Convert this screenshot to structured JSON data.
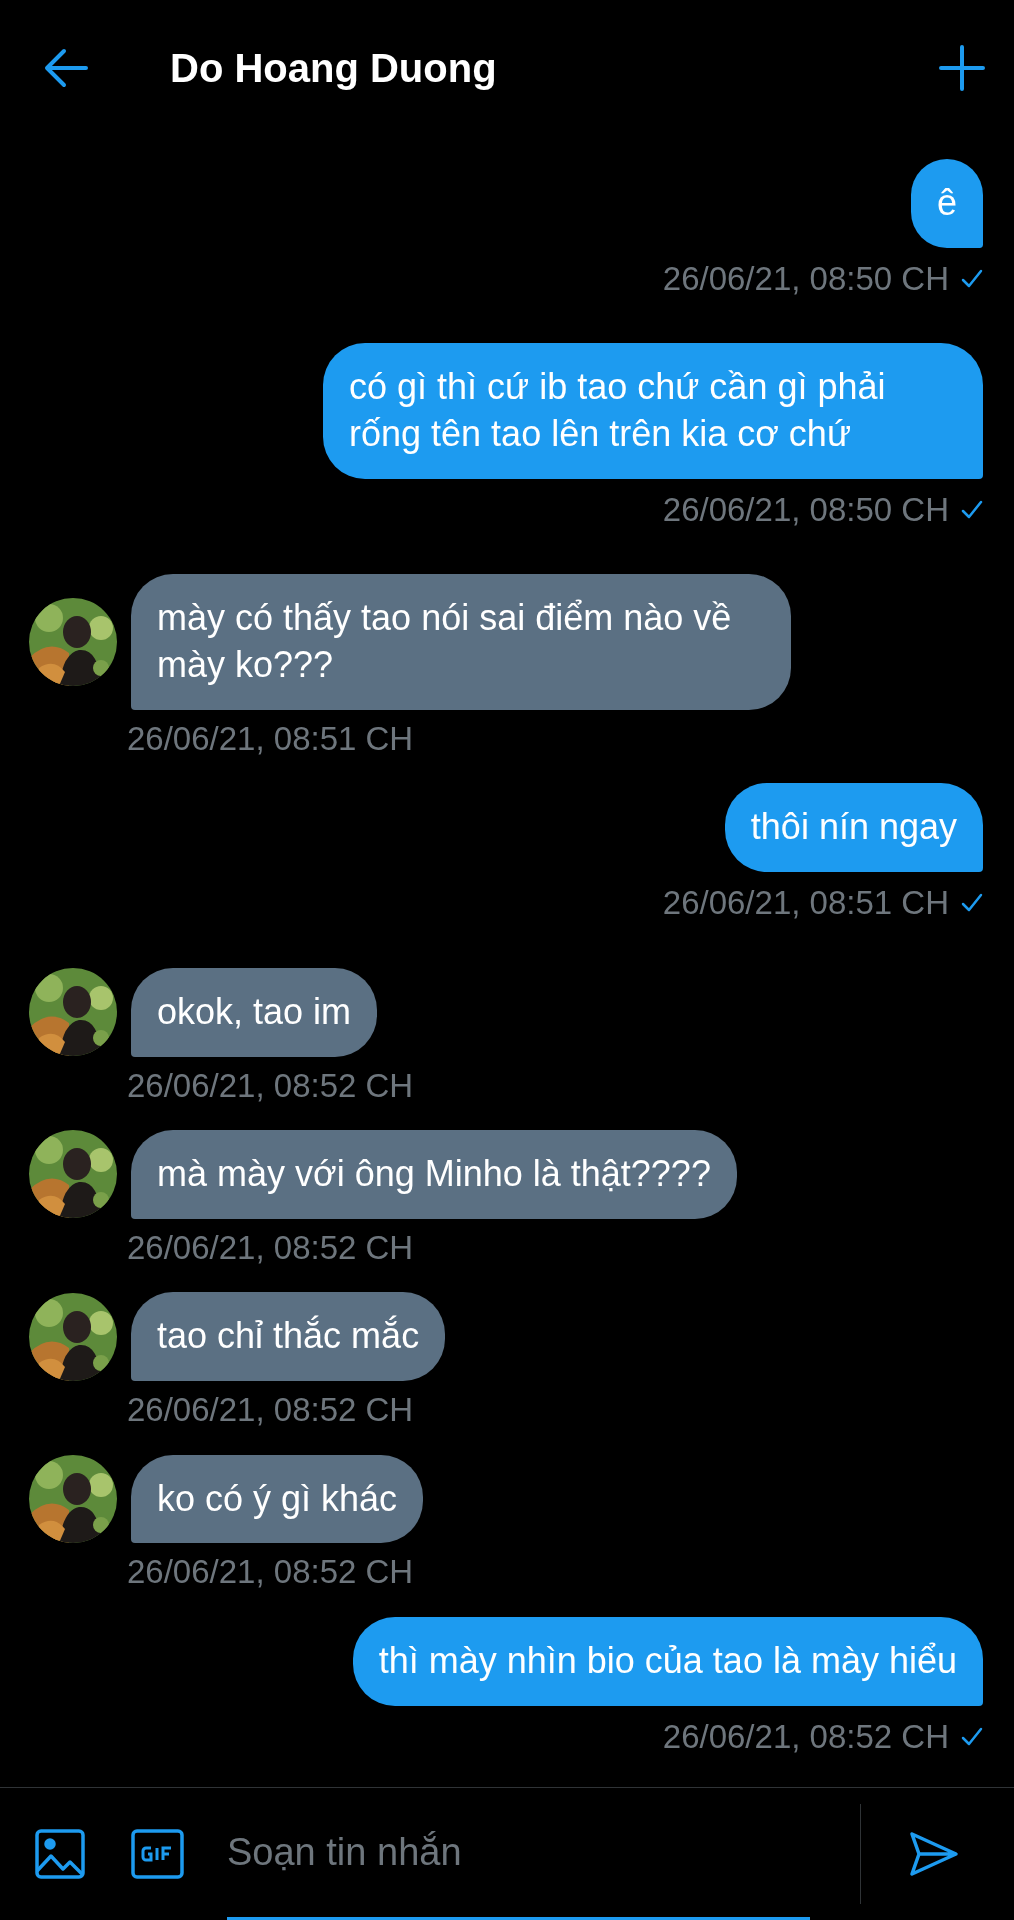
{
  "header": {
    "title": "Do Hoang Duong"
  },
  "messages": [
    {
      "kind": "outgoing",
      "text": "ê",
      "time": "26/06/21, 08:50 CH",
      "seen": true
    },
    {
      "kind": "outgoing",
      "text": "có gì thì cứ ib tao chứ cần gì phải rống tên tao lên trên kia cơ chứ",
      "time": "26/06/21, 08:50 CH",
      "seen": true
    },
    {
      "kind": "incoming",
      "text": "mày có thấy tao nói sai điểm nào về mày ko???",
      "time": "26/06/21, 08:51 CH",
      "avatar": true
    },
    {
      "kind": "outgoing",
      "text": "thôi nín ngay",
      "time": "26/06/21, 08:51 CH",
      "seen": true
    },
    {
      "kind": "incoming",
      "text": "okok, tao im",
      "time": "26/06/21, 08:52 CH",
      "avatar": true
    },
    {
      "kind": "incoming",
      "text": "mà mày với ông Minho là thật????",
      "time": "26/06/21, 08:52 CH",
      "avatar": true
    },
    {
      "kind": "incoming",
      "text": "tao chỉ thắc mắc",
      "time": "26/06/21, 08:52 CH",
      "avatar": true
    },
    {
      "kind": "incoming",
      "text": "ko có ý gì khác",
      "time": "26/06/21, 08:52 CH",
      "avatar": true
    },
    {
      "kind": "outgoing",
      "text": "thì mày nhìn bio của tao là mày hiểu",
      "time": "26/06/21, 08:52 CH",
      "seen": true
    }
  ],
  "composer": {
    "placeholder": "Soạn tin nhắn"
  }
}
